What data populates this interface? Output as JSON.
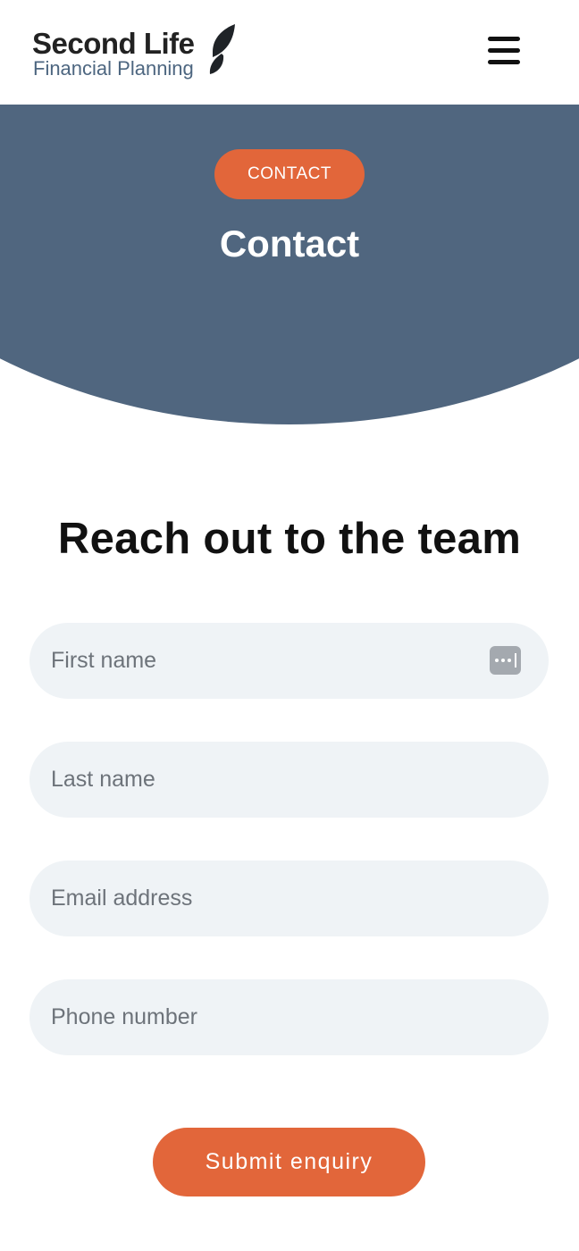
{
  "header": {
    "logo": {
      "line1": "Second Life",
      "line2": "Financial Planning"
    },
    "menu_icon": "hamburger-menu-icon"
  },
  "hero": {
    "badge": "CONTACT",
    "title": "Contact"
  },
  "form": {
    "title": "Reach out to the team",
    "fields": {
      "first_name": {
        "placeholder": "First name",
        "value": ""
      },
      "last_name": {
        "placeholder": "Last name",
        "value": ""
      },
      "email": {
        "placeholder": "Email address",
        "value": ""
      },
      "phone": {
        "placeholder": "Phone number",
        "value": ""
      }
    },
    "autofill_icon": "password-autofill-icon",
    "submit_label": "Submit enquiry"
  },
  "colors": {
    "accent": "#e2663a",
    "hero_bg": "#50667f",
    "field_bg": "#eff3f6",
    "text_dark": "#111111"
  }
}
